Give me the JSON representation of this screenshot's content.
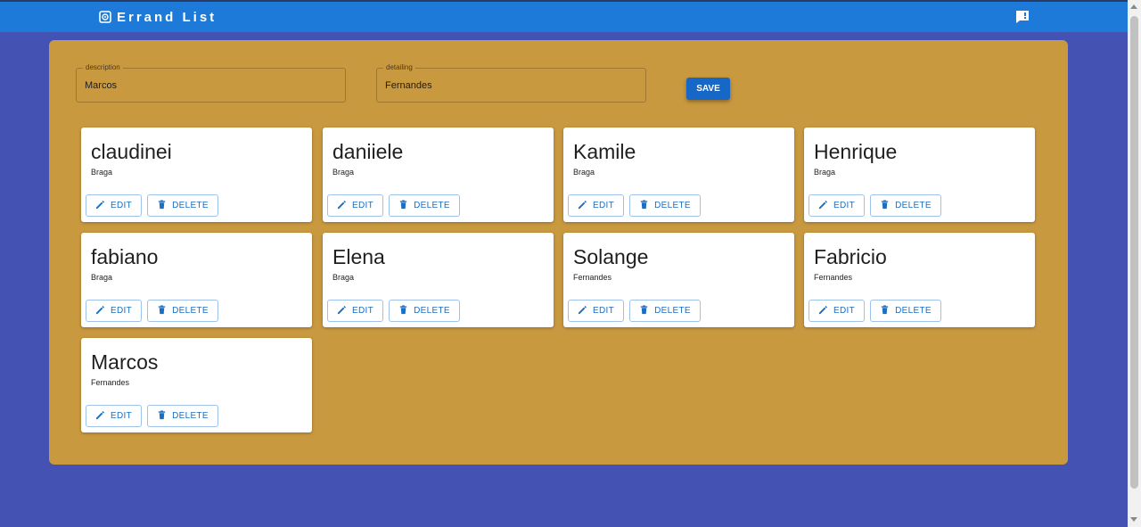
{
  "appbar": {
    "title": "Errand List",
    "brand_icon": "target-icon",
    "action_icon": "feedback-icon",
    "color": "#1d7ad8"
  },
  "form": {
    "description": {
      "label": "description",
      "value": "Marcos"
    },
    "detailing": {
      "label": "detailing",
      "value": "Fernandes"
    },
    "save_label": "SAVE"
  },
  "cards": [
    {
      "title": "claudinei",
      "subtitle": "Braga",
      "edit_label": "EDIT",
      "delete_label": "DELETE"
    },
    {
      "title": "daniiele",
      "subtitle": "Braga",
      "edit_label": "EDIT",
      "delete_label": "DELETE"
    },
    {
      "title": "Kamile",
      "subtitle": "Braga",
      "edit_label": "EDIT",
      "delete_label": "DELETE"
    },
    {
      "title": "Henrique",
      "subtitle": "Braga",
      "edit_label": "EDIT",
      "delete_label": "DELETE"
    },
    {
      "title": "fabiano",
      "subtitle": "Braga",
      "edit_label": "EDIT",
      "delete_label": "DELETE"
    },
    {
      "title": "Elena",
      "subtitle": "Braga",
      "edit_label": "EDIT",
      "delete_label": "DELETE"
    },
    {
      "title": "Solange",
      "subtitle": "Fernandes",
      "edit_label": "EDIT",
      "delete_label": "DELETE"
    },
    {
      "title": "Fabricio",
      "subtitle": "Fernandes",
      "edit_label": "EDIT",
      "delete_label": "DELETE"
    },
    {
      "title": "Marcos",
      "subtitle": "Fernandes",
      "edit_label": "EDIT",
      "delete_label": "DELETE"
    }
  ],
  "colors": {
    "background": "#4352b3",
    "panel": "#c9993f",
    "accent": "#1767c6"
  }
}
